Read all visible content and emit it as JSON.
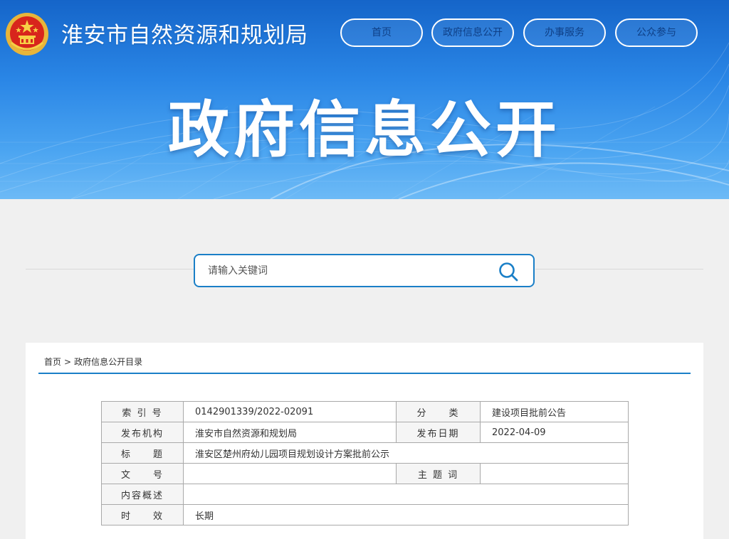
{
  "header": {
    "site_title": "淮安市自然资源和规划局",
    "hero_title": "政府信息公开",
    "nav": [
      {
        "label": "首页"
      },
      {
        "label": "政府信息公开"
      },
      {
        "label": "办事服务"
      },
      {
        "label": "公众参与"
      }
    ]
  },
  "search": {
    "placeholder": "请输入关键词",
    "value": ""
  },
  "breadcrumb": {
    "home": "首页",
    "separator": ">",
    "current": "政府信息公开目录"
  },
  "info_table": {
    "index_label": "索 引 号",
    "index_value": "0142901339/2022-02091",
    "category_label": "分　　类",
    "category_value": "建设项目批前公告",
    "publisher_label": "发布机构",
    "publisher_value": "淮安市自然资源和规划局",
    "date_label": "发布日期",
    "date_value": "2022-04-09",
    "title_label": "标　　题",
    "title_value": "淮安区楚州府幼儿园项目规划设计方案批前公示",
    "doc_no_label": "文　　号",
    "doc_no_value": "",
    "keywords_label": "主 题 词",
    "keywords_value": "",
    "summary_label": "内容概述",
    "summary_value": "",
    "validity_label": "时　　效",
    "validity_value": "长期"
  },
  "colors": {
    "accent": "#1a7fc7",
    "banner_top": "#1565c9",
    "banner_bottom": "#6dbaf6",
    "nav_text": "#0e3f86"
  },
  "icons": {
    "emblem": "national-emblem-icon",
    "search": "search-icon"
  }
}
